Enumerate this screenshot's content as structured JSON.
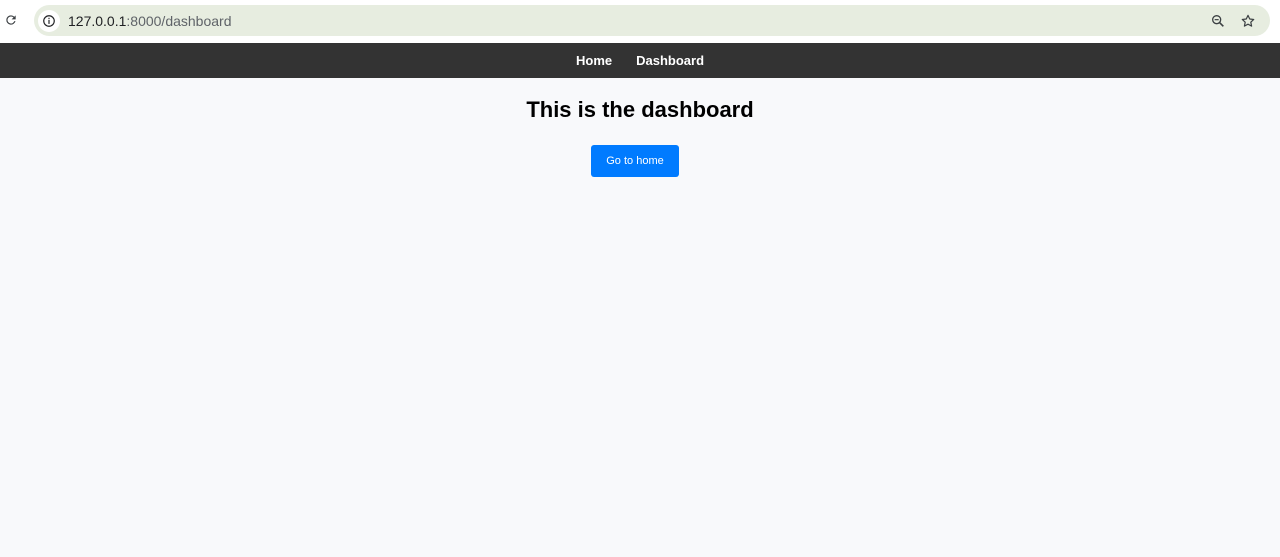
{
  "browser": {
    "url_host": "127.0.0.1",
    "url_rest": ":8000/dashboard"
  },
  "nav": {
    "items": [
      {
        "label": "Home"
      },
      {
        "label": "Dashboard"
      }
    ]
  },
  "main": {
    "title": "This is the dashboard",
    "home_button_label": "Go to home"
  },
  "icons": {
    "reload": "reload-icon",
    "site_info": "info-icon",
    "zoom": "zoom-icon",
    "bookmark": "star-icon"
  },
  "colors": {
    "nav_bg": "#333333",
    "button_bg": "#007bff",
    "page_bg": "#f8f9fb",
    "omnibox_bg": "#e7ede0"
  }
}
